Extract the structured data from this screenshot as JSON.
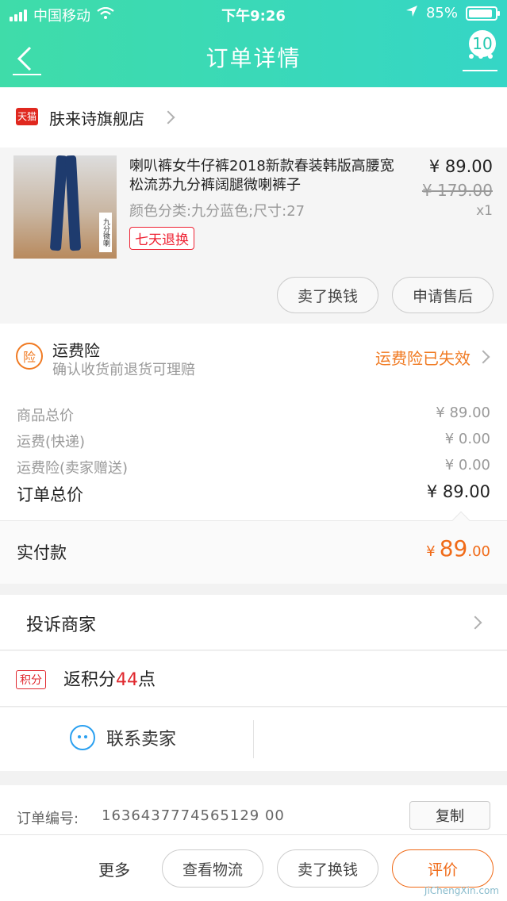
{
  "status_bar": {
    "carrier": "中国移动",
    "time": "下午9:26",
    "battery": "85%"
  },
  "nav": {
    "title": "订单详情",
    "badge": "10"
  },
  "shop": {
    "badge": "天猫",
    "name": "肤来诗旗舰店"
  },
  "product": {
    "title": "喇叭裤女牛仔裤2018新款春装韩版高腰宽松流苏九分裤阔腿微喇裤子",
    "attributes": "颜色分类:九分蓝色;尺寸:27",
    "return_tag": "七天退换",
    "price": "¥ 89.00",
    "original_price": "¥ 179.00",
    "quantity": "x1",
    "image_tag": "九分微喇",
    "buttons": {
      "sell": "卖了换钱",
      "after_sale": "申请售后"
    }
  },
  "insurance": {
    "icon": "险",
    "title": "运费险",
    "subtitle": "确认收货前退货可理赔",
    "status": "运费险已失效"
  },
  "summary": {
    "rows": [
      {
        "label": "商品总价",
        "value": "¥ 89.00"
      },
      {
        "label": "运费(快递)",
        "value": "¥ 0.00"
      },
      {
        "label": "运费险(卖家赠送)",
        "value": "¥ 0.00"
      }
    ],
    "total_label": "订单总价",
    "total_value": "¥ 89.00",
    "paid_label": "实付款",
    "paid_symbol": "¥",
    "paid_int": "89",
    "paid_dec": ".00"
  },
  "complaint": {
    "label": "投诉商家"
  },
  "points": {
    "tag": "积分",
    "prefix": "返积分",
    "num": "44",
    "suffix": "点"
  },
  "contact": {
    "label": "联系卖家"
  },
  "order": {
    "label": "订单编号:",
    "number": "1636437774565129 00",
    "copy": "复制"
  },
  "bottom": {
    "more": "更多",
    "logistics": "查看物流",
    "sell": "卖了换钱",
    "rate": "评价"
  },
  "watermark": "JiChengXin.com",
  "colors": {
    "header_start": "#3fdca9",
    "header_end": "#35d6c6",
    "accent_orange": "#f06a17",
    "tmall_red": "#e0281f"
  },
  "icons": [
    "signal-icon",
    "wifi-icon",
    "location-icon",
    "battery-icon",
    "back-icon",
    "more-icon",
    "chevron-right-icon",
    "insurance-icon",
    "contact-icon"
  ]
}
